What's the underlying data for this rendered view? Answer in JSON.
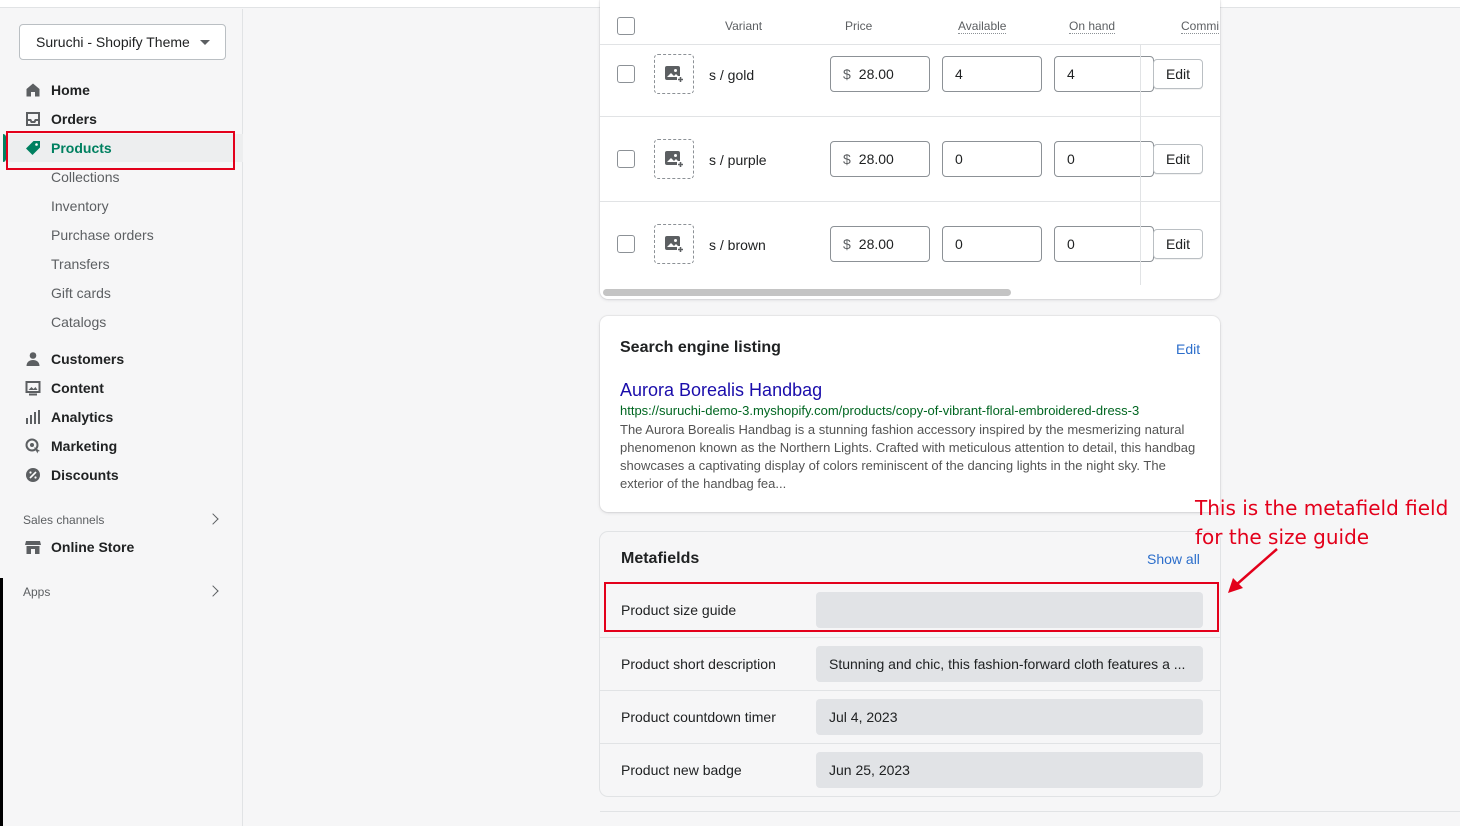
{
  "store": {
    "name": "Suruchi - Shopify Theme"
  },
  "nav": {
    "home": "Home",
    "orders": "Orders",
    "products": "Products",
    "product_subs": [
      "Collections",
      "Inventory",
      "Purchase orders",
      "Transfers",
      "Gift cards",
      "Catalogs"
    ],
    "customers": "Customers",
    "content": "Content",
    "analytics": "Analytics",
    "marketing": "Marketing",
    "discounts": "Discounts",
    "sales_channels": "Sales channels",
    "online_store": "Online Store",
    "apps": "Apps"
  },
  "variants": {
    "headers": {
      "variant": "Variant",
      "price": "Price",
      "available": "Available",
      "on_hand": "On hand",
      "committed": "Commi"
    },
    "currency": "$",
    "edit_label": "Edit",
    "rows": [
      {
        "name": "s / gold",
        "price": "28.00",
        "available": "4",
        "on_hand": "4"
      },
      {
        "name": "s / purple",
        "price": "28.00",
        "available": "0",
        "on_hand": "0"
      },
      {
        "name": "s / brown",
        "price": "28.00",
        "available": "0",
        "on_hand": "0"
      }
    ]
  },
  "seo": {
    "title": "Search engine listing",
    "edit": "Edit",
    "page_title": "Aurora Borealis Handbag",
    "url": "https://suruchi-demo-3.myshopify.com/products/copy-of-vibrant-floral-embroidered-dress-3",
    "description": "The Aurora Borealis Handbag is a stunning fashion accessory inspired by the mesmerizing natural phenomenon known as the Northern Lights. Crafted with meticulous attention to detail, this handbag showcases a captivating display of colors reminiscent of the dancing lights in the night sky. The exterior of the handbag fea..."
  },
  "metafields": {
    "title": "Metafields",
    "show_all": "Show all",
    "rows": [
      {
        "label": "Product size guide",
        "value": ""
      },
      {
        "label": "Product short description",
        "value": "Stunning and chic, this fashion-forward cloth features a ..."
      },
      {
        "label": "Product countdown timer",
        "value": "Jul 4, 2023"
      },
      {
        "label": "Product new badge",
        "value": "Jun 25, 2023"
      }
    ]
  },
  "annotation": {
    "line1": "This is the metafield field",
    "line2": "for the size guide"
  },
  "colors": {
    "accent": "#008060",
    "link": "#2c6ecb",
    "annotation": "#e3001b"
  }
}
